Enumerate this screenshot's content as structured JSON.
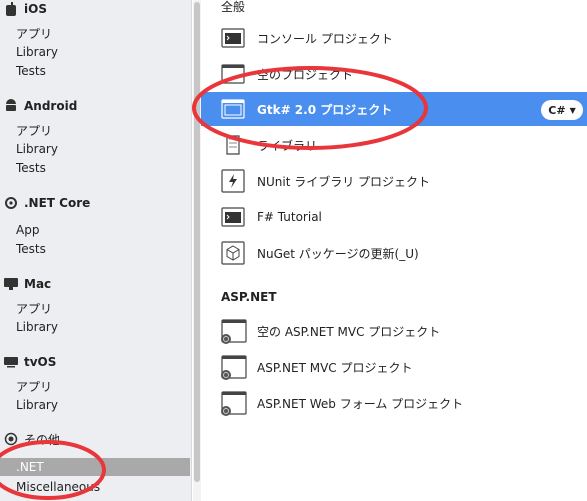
{
  "sidebar": {
    "categories": [
      {
        "name": "iOS",
        "icon": "apple-icon",
        "items": [
          "アプリ",
          "Library",
          "Tests"
        ]
      },
      {
        "name": "Android",
        "icon": "android-icon",
        "items": [
          "アプリ",
          "Library",
          "Tests"
        ]
      },
      {
        "name": ".NET Core",
        "icon": "dotnet-core-icon",
        "items": [
          "App",
          "Tests"
        ]
      },
      {
        "name": "Mac",
        "icon": "mac-icon",
        "items": [
          "アプリ",
          "Library"
        ]
      },
      {
        "name": "tvOS",
        "icon": "tv-icon",
        "items": [
          "アプリ",
          "Library"
        ]
      },
      {
        "name": "その他",
        "icon": "other-icon",
        "items": [
          ".NET",
          "Miscellaneous"
        ]
      }
    ],
    "selected": ".NET"
  },
  "main": {
    "groups": [
      {
        "title": "全般",
        "templates": [
          {
            "label": "コンソール プロジェクト",
            "icon": "console-icon"
          },
          {
            "label": "空のプロジェクト",
            "icon": "empty-project-icon"
          },
          {
            "label": "Gtk# 2.0 プロジェクト",
            "icon": "window-icon",
            "selected": true,
            "language": "C#"
          },
          {
            "label": "ライブラリ",
            "icon": "library-icon"
          },
          {
            "label": "NUnit ライブラリ プロジェクト",
            "icon": "nunit-icon"
          },
          {
            "label": "F# Tutorial",
            "icon": "console-icon"
          },
          {
            "label": "NuGet パッケージの更新(_U)",
            "icon": "nuget-icon"
          }
        ]
      },
      {
        "title": "ASP.NET",
        "templates": [
          {
            "label": "空の ASP.NET MVC プロジェクト",
            "icon": "web-project-icon"
          },
          {
            "label": "ASP.NET MVC プロジェクト",
            "icon": "web-project-icon"
          },
          {
            "label": "ASP.NET Web フォーム プロジェクト",
            "icon": "web-project-icon"
          }
        ]
      }
    ]
  },
  "colors": {
    "selection": "#4a8ef0",
    "sidebar_selection": "#a9a9a9",
    "annotation": "#e8363a"
  }
}
